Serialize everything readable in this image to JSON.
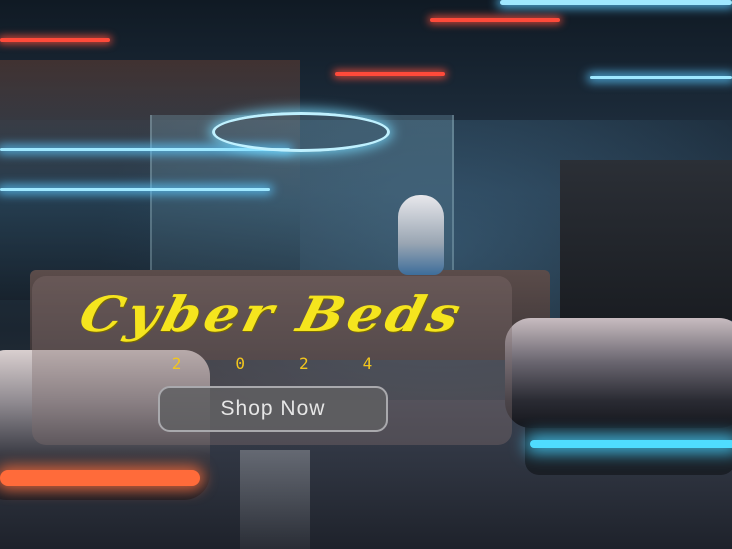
{
  "promo": {
    "logo_text": "Cyber Beds",
    "year_digits": [
      "2",
      "0",
      "2",
      "4"
    ],
    "button_label": "Shop Now"
  },
  "colors": {
    "logo": "#f5e51e",
    "year": "#f2c61e",
    "button_bg": "#5f5f62",
    "button_border": "#a9a9ad"
  }
}
